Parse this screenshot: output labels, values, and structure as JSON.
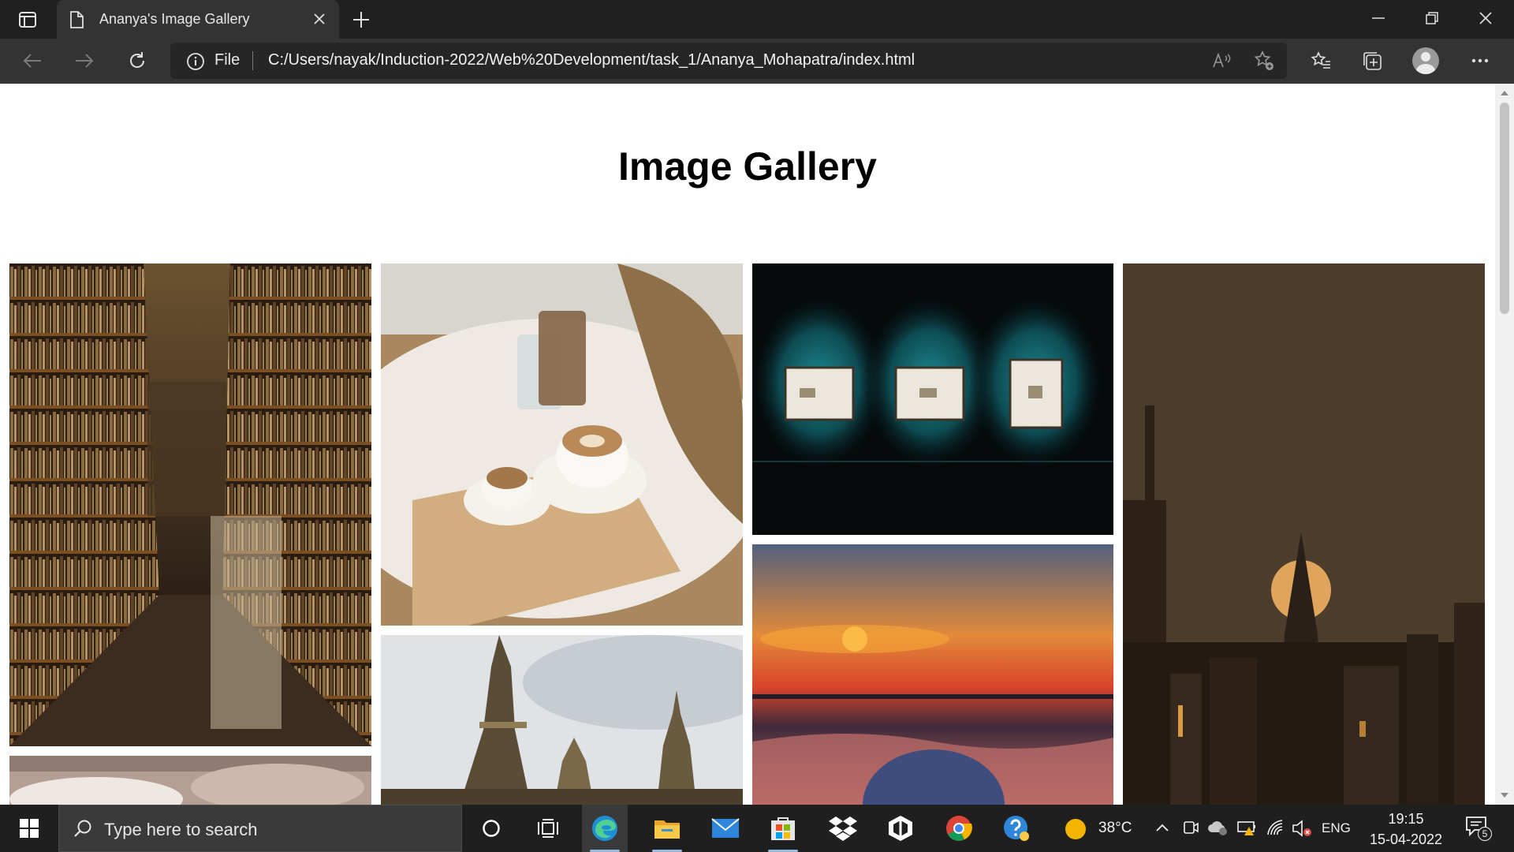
{
  "browser": {
    "tab_title": "Ananya's Image Gallery",
    "address_prefix": "File",
    "url": "C:/Users/nayak/Induction-2022/Web%20Development/task_1/Ananya_Mohapatra/index.html"
  },
  "page": {
    "heading": "Image Gallery",
    "images": [
      {
        "subject": "bookshop-aisle"
      },
      {
        "subject": "coffee-table"
      },
      {
        "subject": "gallery-frames"
      },
      {
        "subject": "city-moonrise"
      },
      {
        "subject": "bedroom-partial"
      },
      {
        "subject": "sunset-sea"
      },
      {
        "subject": "cathedral-spires"
      }
    ]
  },
  "taskbar": {
    "search_placeholder": "Type here to search",
    "weather_temp": "38°C",
    "language": "ENG",
    "time": "19:15",
    "date": "15-04-2022",
    "notification_count": "5",
    "pinned_apps": [
      "cortana",
      "task-view",
      "edge",
      "file-explorer",
      "mail",
      "store",
      "dropbox",
      "app-hexagon",
      "chrome",
      "help"
    ]
  },
  "colors": {
    "chrome_dark": "#202020",
    "toolbar": "#333333",
    "page_bg": "#ffffff",
    "taskbar": "#1f1f1f"
  }
}
